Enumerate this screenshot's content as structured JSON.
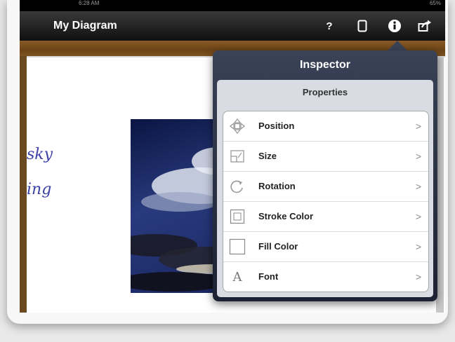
{
  "status_bar": {
    "time": "6:28 AM",
    "battery": "65%"
  },
  "navbar": {
    "title": "My Diagram",
    "help_label": "?",
    "icons": [
      "help-icon",
      "page-icon",
      "info-icon",
      "share-icon"
    ]
  },
  "canvas": {
    "handwriting": [
      "sky",
      "ing"
    ],
    "image": "sky-with-clouds-photo"
  },
  "inspector": {
    "title": "Inspector",
    "section": "Properties",
    "items": [
      {
        "label": "Position",
        "icon": "position-icon",
        "chevron": ">"
      },
      {
        "label": "Size",
        "icon": "size-icon",
        "chevron": ">"
      },
      {
        "label": "Rotation",
        "icon": "rotation-icon",
        "chevron": ">"
      },
      {
        "label": "Stroke Color",
        "icon": "stroke-color-icon",
        "chevron": ">"
      },
      {
        "label": "Fill Color",
        "icon": "fill-color-icon",
        "chevron": ">"
      },
      {
        "label": "Font",
        "icon": "font-icon",
        "glyph": "A",
        "chevron": ">"
      }
    ]
  },
  "colors": {
    "navbar": "#1a1a1a",
    "popover": "#2b3244",
    "handwriting": "#3b3fa8",
    "wood": "#6b4418"
  }
}
